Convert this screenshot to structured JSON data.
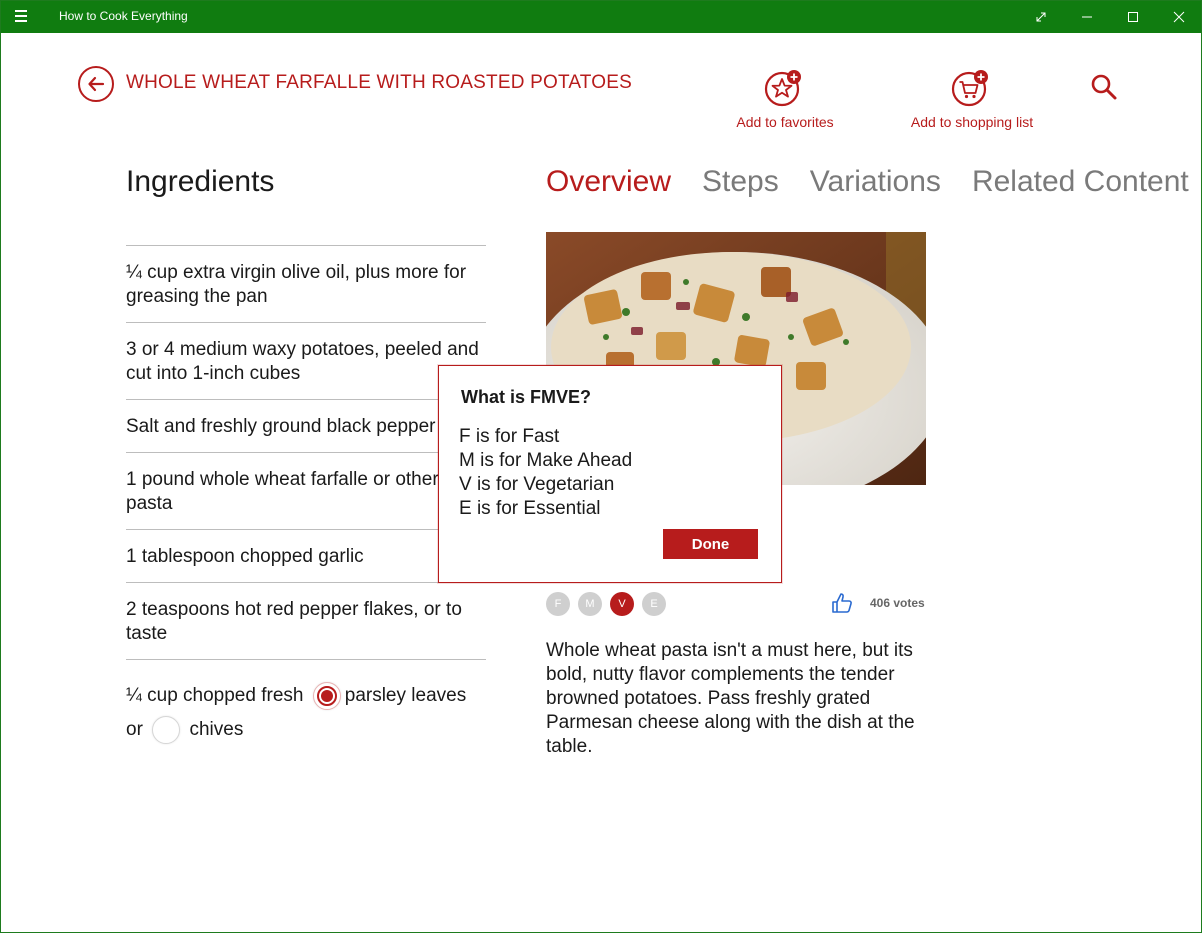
{
  "window": {
    "app_title": "How to Cook Everything"
  },
  "header": {
    "recipe_title": "WHOLE WHEAT FARFALLE WITH ROASTED POTATOES",
    "favorites_label": "Add to favorites",
    "shopping_label": "Add to shopping list"
  },
  "ingredients": {
    "heading": "Ingredients",
    "items": [
      "¼ cup extra virgin olive oil, plus more for greasing the pan",
      "3 or 4 medium waxy potatoes, peeled and cut into 1-inch cubes",
      "Salt and freshly ground black pepper",
      "1 pound whole wheat farfalle or other cut pasta",
      "1 tablespoon chopped garlic",
      "2 teaspoons hot red pepper flakes, or to taste"
    ],
    "last_item": {
      "prefix": "¼ cup chopped fresh",
      "option_a": "parsley leaves",
      "joiner": "or",
      "option_b": "chives",
      "selected": "parsley leaves"
    }
  },
  "tabs": [
    "Overview",
    "Steps",
    "Variations",
    "Related Content"
  ],
  "active_tab": "Overview",
  "overview": {
    "badges": [
      "F",
      "M",
      "V",
      "E"
    ],
    "active_badges": [
      "V"
    ],
    "votes": "406 votes",
    "description": "Whole wheat pasta isn't a must here, but its bold, nutty flavor complements the tender browned potatoes. Pass freshly grated Parmesan cheese along with the dish at the table."
  },
  "dialog": {
    "title": "What is FMVE?",
    "lines": [
      "F is for Fast",
      "M is for Make Ahead",
      "V is for Vegetarian",
      "E is for Essential"
    ],
    "done_label": "Done"
  },
  "colors": {
    "accent": "#b71c1c",
    "titlebar": "#107c10",
    "inactive_tab": "#7a7a7a"
  }
}
